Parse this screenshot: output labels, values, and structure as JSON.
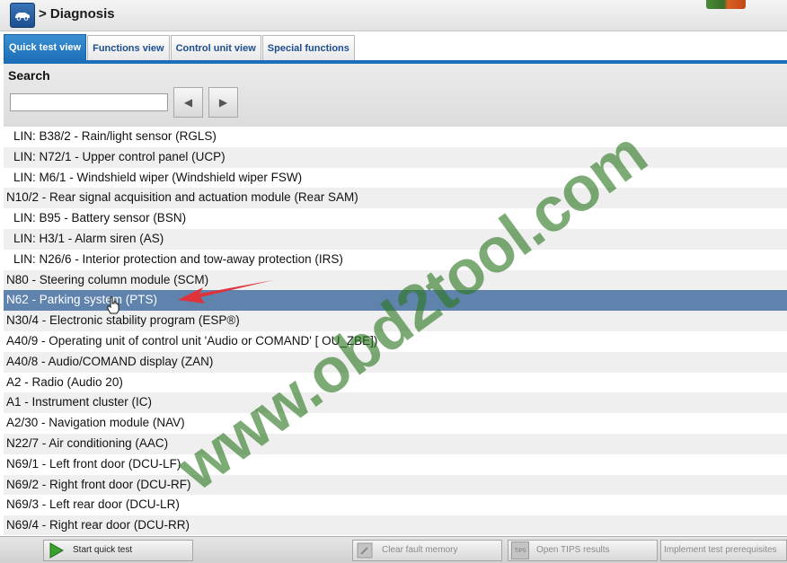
{
  "header": {
    "breadcrumb": "> Diagnosis"
  },
  "tabs": [
    {
      "label": "Quick test view",
      "active": true
    },
    {
      "label": "Functions view",
      "active": false
    },
    {
      "label": "Control unit view",
      "active": false
    },
    {
      "label": "Special functions",
      "active": false
    }
  ],
  "search": {
    "title": "Search",
    "value": "",
    "placeholder": "",
    "prev_glyph": "◀",
    "next_glyph": "▶"
  },
  "list": {
    "items": [
      {
        "label": "LIN: B38/2 - Rain/light sensor (RGLS)",
        "indent": true
      },
      {
        "label": "LIN: N72/1 - Upper control panel (UCP)",
        "indent": true
      },
      {
        "label": "LIN: M6/1 - Windshield wiper (Windshield wiper FSW)",
        "indent": true
      },
      {
        "label": "N10/2 - Rear signal acquisition and actuation module (Rear SAM)",
        "indent": false
      },
      {
        "label": "LIN: B95 - Battery sensor (BSN)",
        "indent": true
      },
      {
        "label": "LIN: H3/1 - Alarm siren (AS)",
        "indent": true
      },
      {
        "label": "LIN: N26/6 - Interior protection and tow-away protection (IRS)",
        "indent": true
      },
      {
        "label": "N80 - Steering column module (SCM)",
        "indent": false
      },
      {
        "label": "N62 - Parking system (PTS)",
        "indent": false,
        "selected": true
      },
      {
        "label": "N30/4 - Electronic stability program (ESP®)",
        "indent": false
      },
      {
        "label": "A40/9 - Operating unit of control unit 'Audio or COMAND' [ OU_ZBE])",
        "indent": false
      },
      {
        "label": "A40/8 - Audio/COMAND display (ZAN)",
        "indent": false
      },
      {
        "label": "A2 - Radio (Audio 20)",
        "indent": false
      },
      {
        "label": "A1 - Instrument cluster (IC)",
        "indent": false
      },
      {
        "label": "A2/30 - Navigation module (NAV)",
        "indent": false
      },
      {
        "label": "N22/7 - Air conditioning (AAC)",
        "indent": false
      },
      {
        "label": "N69/1 - Left front door (DCU-LF)",
        "indent": false
      },
      {
        "label": "N69/2 - Right front door (DCU-RF)",
        "indent": false
      },
      {
        "label": "N69/3 - Left rear door (DCU-LR)",
        "indent": false
      },
      {
        "label": "N69/4 - Right rear door (DCU-RR)",
        "indent": false
      }
    ]
  },
  "bottom": {
    "start_quick_test": "Start quick test",
    "clear_fault_memory": "Clear fault memory",
    "tips_icon_text": "TIPS",
    "open_tips_results": "Open TIPS results",
    "implement_test_prerequisites": "Implement test prerequisites"
  },
  "watermark": {
    "text": "www.obd2tool.com"
  },
  "colors": {
    "accent": "#1c6fb8",
    "selected_row": "#5f83ad",
    "watermark": "#2c7820",
    "arrow": "#e0323a",
    "play_icon": "#3aa02e"
  },
  "icons": {
    "header_button": "car-icon",
    "start_button": "play-icon",
    "clear_button": "tool-icon",
    "tips_button": "tips-icon",
    "top_right": "toolbar-graphic-icon"
  }
}
